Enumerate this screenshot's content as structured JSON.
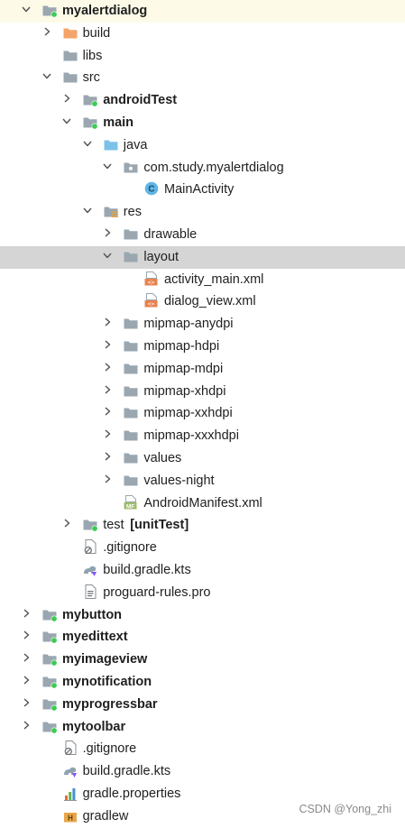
{
  "tree": [
    {
      "label": "myalertdialog",
      "bold": true,
      "depth": 0,
      "chevron": "down",
      "icon": "module-folder-icon",
      "icon_type": "module"
    },
    {
      "label": "build",
      "bold": false,
      "depth": 1,
      "chevron": "right",
      "icon": "build-folder-icon",
      "icon_type": "orange"
    },
    {
      "label": "libs",
      "bold": false,
      "depth": 1,
      "chevron": "none",
      "icon": "folder-icon",
      "icon_type": "folder"
    },
    {
      "label": "src",
      "bold": false,
      "depth": 1,
      "chevron": "down",
      "icon": "folder-icon",
      "icon_type": "folder"
    },
    {
      "label": "androidTest",
      "bold": true,
      "depth": 2,
      "chevron": "right",
      "icon": "source-set-folder-icon",
      "icon_type": "module"
    },
    {
      "label": "main",
      "bold": true,
      "depth": 2,
      "chevron": "down",
      "icon": "source-set-folder-icon",
      "icon_type": "module"
    },
    {
      "label": "java",
      "bold": false,
      "depth": 3,
      "chevron": "down",
      "icon": "java-source-folder-icon",
      "icon_type": "blue"
    },
    {
      "label": "com.study.myalertdialog",
      "bold": false,
      "depth": 4,
      "chevron": "down",
      "icon": "package-icon",
      "icon_type": "package"
    },
    {
      "label": "MainActivity",
      "bold": false,
      "depth": 5,
      "chevron": "none",
      "icon": "kotlin-class-icon",
      "icon_type": "class"
    },
    {
      "label": "res",
      "bold": false,
      "depth": 3,
      "chevron": "down",
      "icon": "resources-folder-icon",
      "icon_type": "res"
    },
    {
      "label": "drawable",
      "bold": false,
      "depth": 4,
      "chevron": "right",
      "icon": "folder-icon",
      "icon_type": "folder"
    },
    {
      "label": "layout",
      "bold": false,
      "depth": 4,
      "chevron": "down",
      "icon": "folder-icon",
      "icon_type": "folder"
    },
    {
      "label": "activity_main.xml",
      "bold": false,
      "depth": 5,
      "chevron": "none",
      "icon": "xml-file-icon",
      "icon_type": "xml"
    },
    {
      "label": "dialog_view.xml",
      "bold": false,
      "depth": 5,
      "chevron": "none",
      "icon": "xml-file-icon",
      "icon_type": "xml"
    },
    {
      "label": "mipmap-anydpi",
      "bold": false,
      "depth": 4,
      "chevron": "right",
      "icon": "folder-icon",
      "icon_type": "folder"
    },
    {
      "label": "mipmap-hdpi",
      "bold": false,
      "depth": 4,
      "chevron": "right",
      "icon": "folder-icon",
      "icon_type": "folder"
    },
    {
      "label": "mipmap-mdpi",
      "bold": false,
      "depth": 4,
      "chevron": "right",
      "icon": "folder-icon",
      "icon_type": "folder"
    },
    {
      "label": "mipmap-xhdpi",
      "bold": false,
      "depth": 4,
      "chevron": "right",
      "icon": "folder-icon",
      "icon_type": "folder"
    },
    {
      "label": "mipmap-xxhdpi",
      "bold": false,
      "depth": 4,
      "chevron": "right",
      "icon": "folder-icon",
      "icon_type": "folder"
    },
    {
      "label": "mipmap-xxxhdpi",
      "bold": false,
      "depth": 4,
      "chevron": "right",
      "icon": "folder-icon",
      "icon_type": "folder"
    },
    {
      "label": "values",
      "bold": false,
      "depth": 4,
      "chevron": "right",
      "icon": "folder-icon",
      "icon_type": "folder"
    },
    {
      "label": "values-night",
      "bold": false,
      "depth": 4,
      "chevron": "right",
      "icon": "folder-icon",
      "icon_type": "folder"
    },
    {
      "label": "AndroidManifest.xml",
      "bold": false,
      "depth": 4,
      "chevron": "none",
      "icon": "manifest-file-icon",
      "icon_type": "manifest"
    },
    {
      "label": "test",
      "label_suffix": "[unitTest]",
      "bold": false,
      "depth": 2,
      "chevron": "right",
      "icon": "source-set-folder-icon",
      "icon_type": "module"
    },
    {
      "label": ".gitignore",
      "bold": false,
      "depth": 2,
      "chevron": "none",
      "icon": "gitignore-file-icon",
      "icon_type": "gitignore"
    },
    {
      "label": "build.gradle.kts",
      "bold": false,
      "depth": 2,
      "chevron": "none",
      "icon": "gradle-kts-file-icon",
      "icon_type": "gradle"
    },
    {
      "label": "proguard-rules.pro",
      "bold": false,
      "depth": 2,
      "chevron": "none",
      "icon": "text-file-icon",
      "icon_type": "text"
    },
    {
      "label": "mybutton",
      "bold": true,
      "depth": 0,
      "chevron": "right",
      "icon": "module-folder-icon",
      "icon_type": "module"
    },
    {
      "label": "myedittext",
      "bold": true,
      "depth": 0,
      "chevron": "right",
      "icon": "module-folder-icon",
      "icon_type": "module"
    },
    {
      "label": "myimageview",
      "bold": true,
      "depth": 0,
      "chevron": "right",
      "icon": "module-folder-icon",
      "icon_type": "module"
    },
    {
      "label": "mynotification",
      "bold": true,
      "depth": 0,
      "chevron": "right",
      "icon": "module-folder-icon",
      "icon_type": "module"
    },
    {
      "label": "myprogressbar",
      "bold": true,
      "depth": 0,
      "chevron": "right",
      "icon": "module-folder-icon",
      "icon_type": "module"
    },
    {
      "label": "mytoolbar",
      "bold": true,
      "depth": 0,
      "chevron": "right",
      "icon": "module-folder-icon",
      "icon_type": "module"
    },
    {
      "label": ".gitignore",
      "bold": false,
      "depth": 1,
      "chevron": "none",
      "icon": "gitignore-file-icon",
      "icon_type": "gitignore"
    },
    {
      "label": "build.gradle.kts",
      "bold": false,
      "depth": 1,
      "chevron": "none",
      "icon": "gradle-kts-file-icon",
      "icon_type": "gradle"
    },
    {
      "label": "gradle.properties",
      "bold": false,
      "depth": 1,
      "chevron": "none",
      "icon": "properties-file-icon",
      "icon_type": "properties"
    },
    {
      "label": "gradlew",
      "bold": false,
      "depth": 1,
      "chevron": "none",
      "icon": "shell-script-file-icon",
      "icon_type": "gradlew"
    }
  ],
  "highlighted_row": "myalertdialog",
  "selected_row": "layout",
  "colors": {
    "folder": "#9aa7b0",
    "module_dot": "#3ccb54",
    "orange_folder": "#f4a46a",
    "blue_folder": "#7cc1e8",
    "class_circle": "#5fb6e4",
    "xml_badge": "#e8824e",
    "row_highlight": "#fdfbe8",
    "row_selected": "#d5d5d5"
  },
  "watermark": "CSDN @Yong_zhi"
}
